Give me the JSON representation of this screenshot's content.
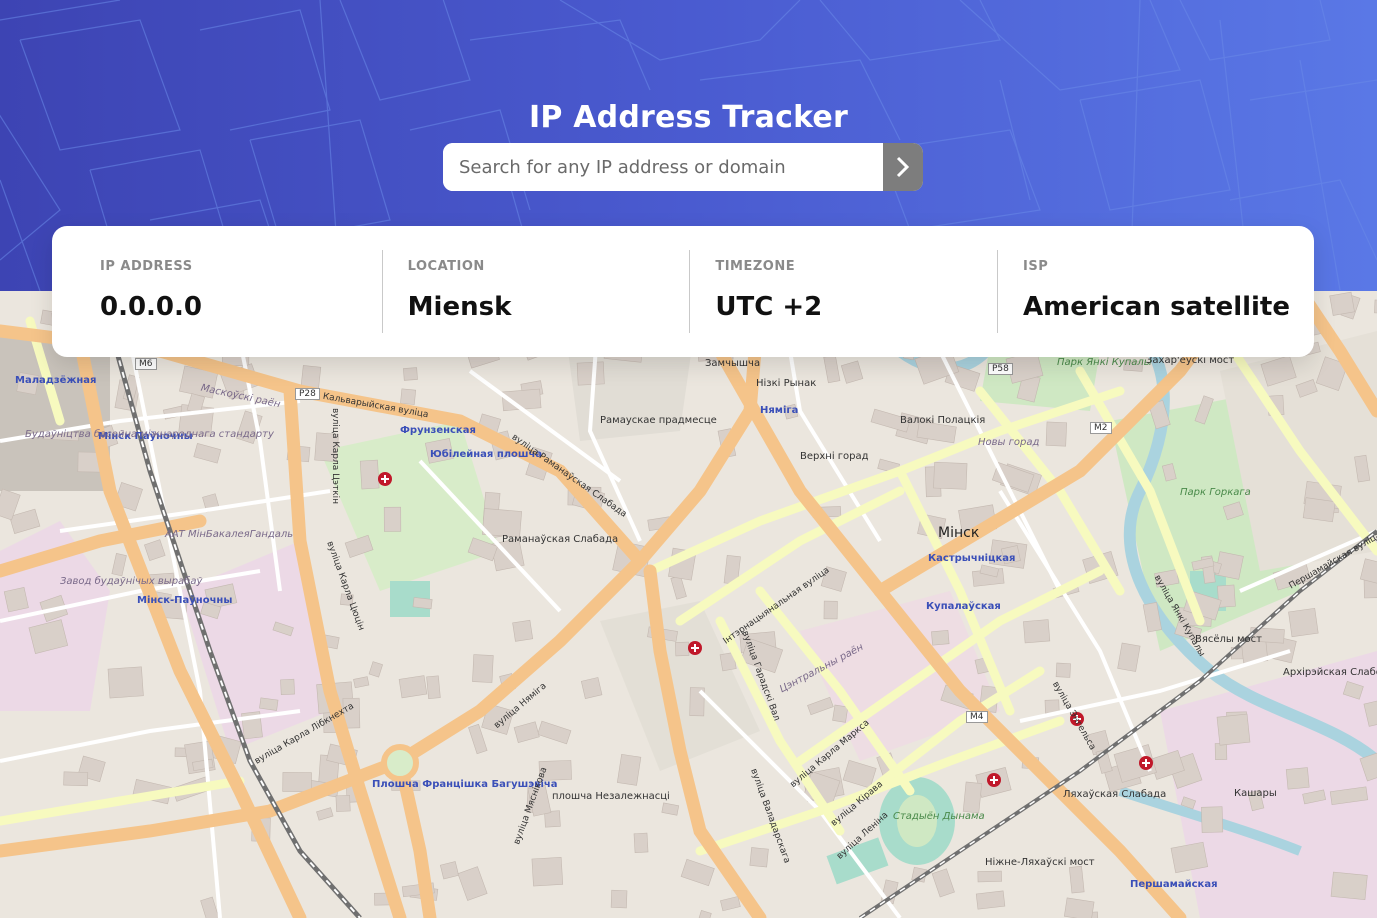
{
  "header": {
    "title": "IP Address Tracker",
    "search_placeholder": "Search for any IP address or domain",
    "search_value": ""
  },
  "info": {
    "ip": {
      "label": "IP ADDRESS",
      "value": "0.0.0.0"
    },
    "location": {
      "label": "LOCATION",
      "value": "Miensk"
    },
    "timezone": {
      "label": "TIMEZONE",
      "value": "UTC +2"
    },
    "isp": {
      "label": "ISP",
      "value": "American satellite"
    }
  },
  "map": {
    "labels": [
      {
        "text": "Маладзёжная",
        "cls": "blue"
      },
      {
        "text": "Мінск",
        "cls": "city"
      },
      {
        "text": "Мінск Паўночны",
        "cls": "blue"
      },
      {
        "text": "Мінск-Паўночны",
        "cls": "blue"
      },
      {
        "text": "Фрунзенская",
        "cls": "blue"
      },
      {
        "text": "Юбілейная плошча",
        "cls": "blue"
      },
      {
        "text": "Няміга",
        "cls": "blue"
      },
      {
        "text": "Кастрычніцкая",
        "cls": "blue"
      },
      {
        "text": "Купалаўская",
        "cls": "blue"
      },
      {
        "text": "Плошча Францішка Багушэвіча",
        "cls": "blue"
      },
      {
        "text": "Першамайская",
        "cls": "blue"
      },
      {
        "text": "Парк Янкі Купалы",
        "cls": "park"
      },
      {
        "text": "Парк Горкага",
        "cls": "park"
      },
      {
        "text": "Стадыён Дынама",
        "cls": "park"
      },
      {
        "text": "Новы горад",
        "cls": "district"
      },
      {
        "text": "Цэнтральны раён",
        "cls": "district"
      },
      {
        "text": "Маскоўскі раён",
        "cls": "district"
      },
      {
        "text": "Рамаускае прадмесце",
        "cls": ""
      },
      {
        "text": "Раманаўская Слабада",
        "cls": ""
      },
      {
        "text": "Верхні горад",
        "cls": ""
      },
      {
        "text": "Нізкі Рынак",
        "cls": ""
      },
      {
        "text": "Валокі Полацкія",
        "cls": ""
      },
      {
        "text": "Замчышча",
        "cls": ""
      },
      {
        "text": "Ляхаўская Слабада",
        "cls": ""
      },
      {
        "text": "Архірэйская Слабодка",
        "cls": ""
      },
      {
        "text": "Кашары",
        "cls": ""
      },
      {
        "text": "плошча Незалежнасці",
        "cls": ""
      },
      {
        "text": "Вясёлы мост",
        "cls": ""
      },
      {
        "text": "Захар'еўскі мост",
        "cls": ""
      },
      {
        "text": "Ніжне-Ляхаўскі мост",
        "cls": ""
      },
      {
        "text": "вуліца Няміга",
        "cls": "road"
      },
      {
        "text": "вуліца Леніна",
        "cls": "road"
      },
      {
        "text": "вуліца Карла Маркса",
        "cls": "road"
      },
      {
        "text": "вуліца Кірава",
        "cls": "road"
      },
      {
        "text": "вуліца Энгельса",
        "cls": "road"
      },
      {
        "text": "вуліца Гарадскі Вал",
        "cls": "road"
      },
      {
        "text": "Інтэрнацыянальная вуліца",
        "cls": "road"
      },
      {
        "text": "Кальварыйская вуліца",
        "cls": "road"
      },
      {
        "text": "вуліца Раманаўская Слабада",
        "cls": "road"
      },
      {
        "text": "вуліца Карла Цэткін",
        "cls": "road"
      },
      {
        "text": "вуліца Карла Цюцін",
        "cls": "road"
      },
      {
        "text": "вуліца Мясніковa",
        "cls": "road"
      },
      {
        "text": "вуліца Валадарскага",
        "cls": "road"
      },
      {
        "text": "вуліца Янкі Купалы",
        "cls": "road"
      },
      {
        "text": "Першамайская вуліца",
        "cls": "road"
      },
      {
        "text": "вуліца Карла Лібкнехта",
        "cls": "road"
      },
      {
        "text": "Будаўніцтва басейна міжнароднага стандарту",
        "cls": "district"
      },
      {
        "text": "Завод будаўнічых вырабаў",
        "cls": "district"
      },
      {
        "text": "ААТ МінБакалеяГандаль",
        "cls": "district"
      },
      {
        "text": "M6",
        "cls": "shield"
      },
      {
        "text": "P28",
        "cls": "shield"
      },
      {
        "text": "P58",
        "cls": "shield"
      },
      {
        "text": "M2",
        "cls": "shield"
      },
      {
        "text": "M4",
        "cls": "shield"
      }
    ]
  }
}
